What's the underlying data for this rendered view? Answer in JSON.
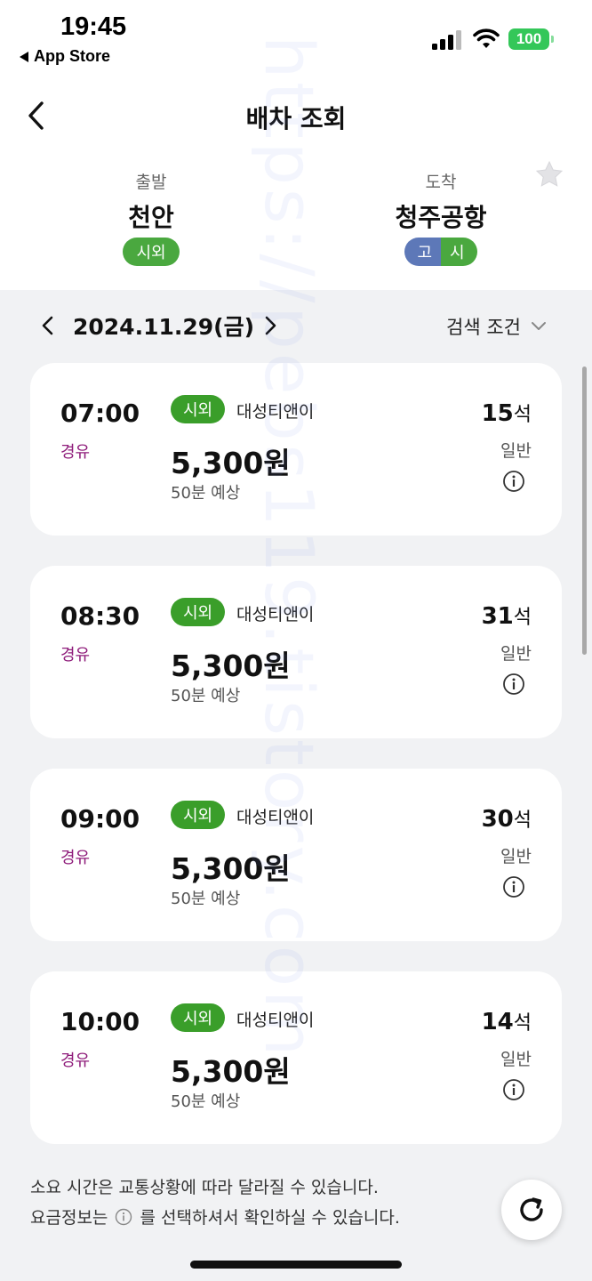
{
  "status_bar": {
    "time": "19:45",
    "back_app": "App Store",
    "battery": "100"
  },
  "header": {
    "title": "배차 조회",
    "departure": {
      "label": "출발",
      "name": "천안",
      "badge": "시외"
    },
    "arrival": {
      "label": "도착",
      "name": "청주공항",
      "badge_left": "고",
      "badge_right": "시"
    }
  },
  "date_bar": {
    "date": "2024.11.29(금)",
    "search_condition": "검색 조건"
  },
  "schedules": [
    {
      "time": "07:00",
      "via": "경유",
      "type": "시외",
      "company": "대성티앤이",
      "fare": "5,300원",
      "duration": "50분 예상",
      "seats": "15",
      "seat_unit": "석",
      "grade": "일반"
    },
    {
      "time": "08:30",
      "via": "경유",
      "type": "시외",
      "company": "대성티앤이",
      "fare": "5,300원",
      "duration": "50분 예상",
      "seats": "31",
      "seat_unit": "석",
      "grade": "일반"
    },
    {
      "time": "09:00",
      "via": "경유",
      "type": "시외",
      "company": "대성티앤이",
      "fare": "5,300원",
      "duration": "50분 예상",
      "seats": "30",
      "seat_unit": "석",
      "grade": "일반"
    },
    {
      "time": "10:00",
      "via": "경유",
      "type": "시외",
      "company": "대성티앤이",
      "fare": "5,300원",
      "duration": "50분 예상",
      "seats": "14",
      "seat_unit": "석",
      "grade": "일반"
    }
  ],
  "notice": {
    "line1": "소요 시간은 교통상황에 따라 달라질 수 있습니다.",
    "line2_before": "요금정보는",
    "line2_after": "를 선택하셔서 확인하실 수 있습니다."
  },
  "watermark": "https://pebs119.tistory.com",
  "colors": {
    "badge_green": "#3a9e2a",
    "via_purple": "#8e1b7a",
    "express_blue": "#5d78b8",
    "battery_green": "#34c759"
  }
}
